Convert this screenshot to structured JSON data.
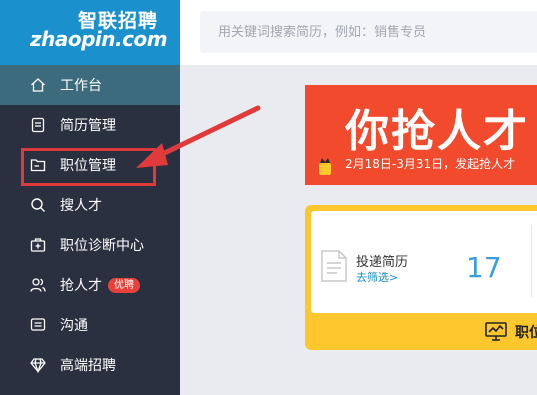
{
  "logo": {
    "top": "智联招聘",
    "bottom": "zhaopin.com"
  },
  "search": {
    "placeholder": "用关键词搜索简历，例如：销售专员"
  },
  "sidebar": {
    "items": [
      {
        "label": "工作台",
        "icon": "home-icon",
        "active": true
      },
      {
        "label": "简历管理",
        "icon": "resume-icon"
      },
      {
        "label": "职位管理",
        "icon": "folder-icon"
      },
      {
        "label": "搜人才",
        "icon": "search-icon"
      },
      {
        "label": "职位诊断中心",
        "icon": "medical-kit-icon"
      },
      {
        "label": "抢人才",
        "icon": "users-icon",
        "badge": "优聘"
      },
      {
        "label": "沟通",
        "icon": "chat-icon"
      },
      {
        "label": "高端招聘",
        "icon": "diamond-icon"
      }
    ]
  },
  "banner": {
    "title": "你抢人才",
    "subtitle": "2月18日-3月31日，发起抢人才"
  },
  "stat_card": {
    "label": "投递简历",
    "link": "去筛选>",
    "count": "17",
    "footer": "职位"
  },
  "colors": {
    "sidebar": "#2b3040",
    "logo_bg": "#1a90cc",
    "banner": "#f24a2d",
    "card_border": "#ffc72e",
    "annotation": "#e13a3a"
  }
}
